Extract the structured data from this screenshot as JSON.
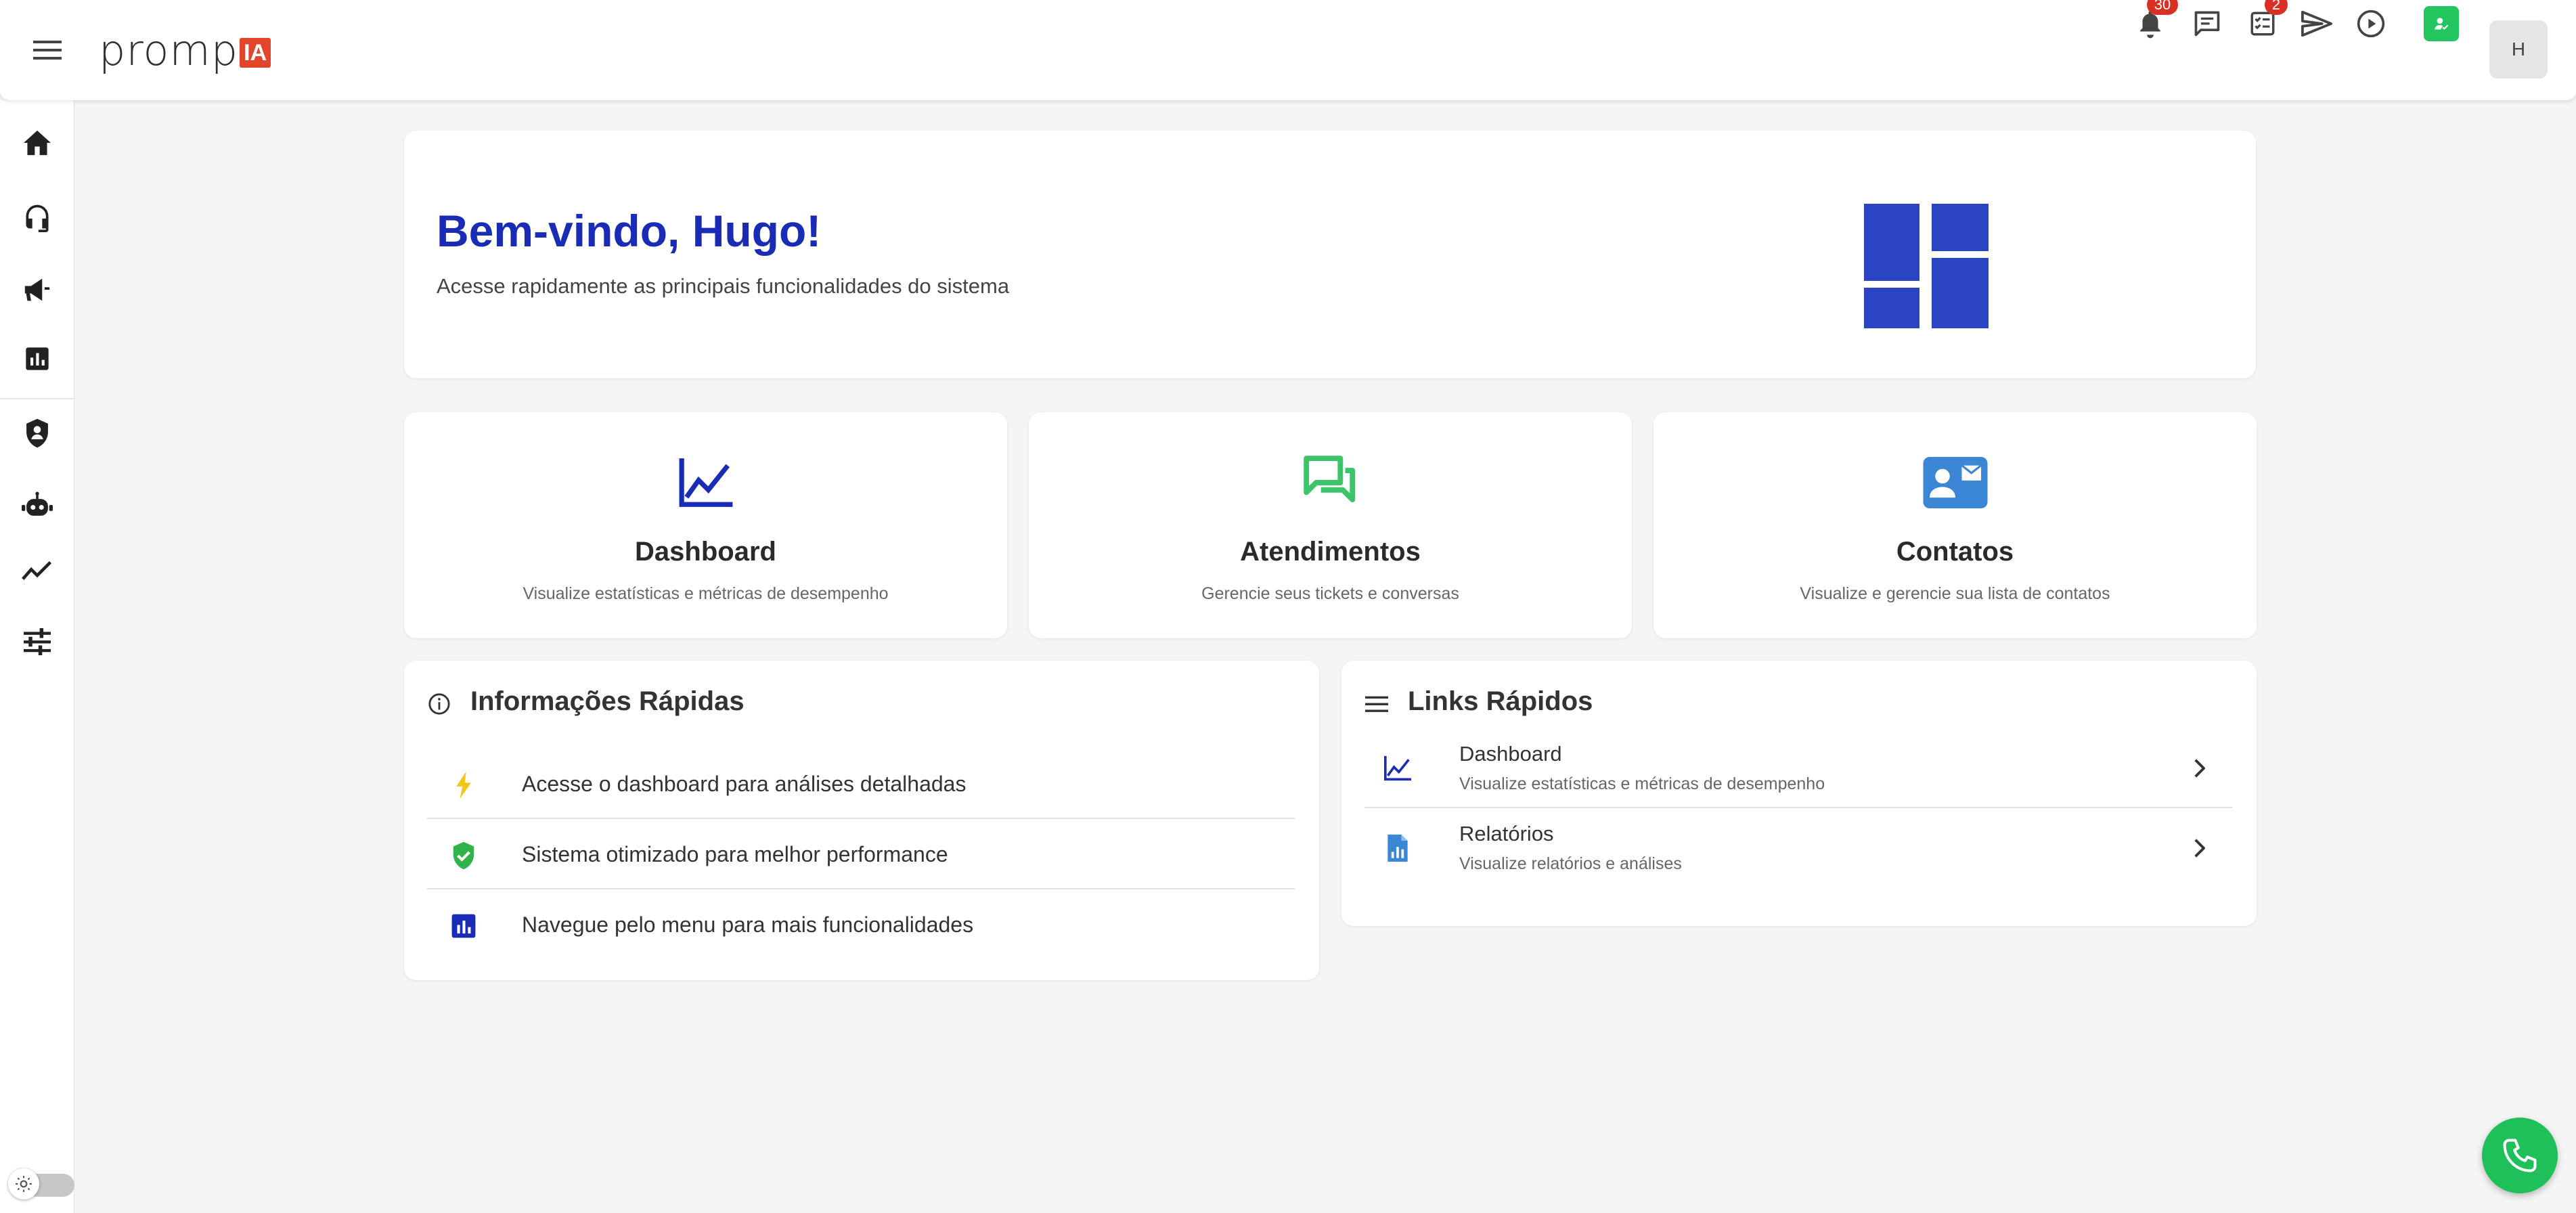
{
  "app": {
    "logo_text": "promp",
    "logo_badge": "IA"
  },
  "header": {
    "notifications_count": "30",
    "tasks_count": "2",
    "user_initial": "H"
  },
  "welcome": {
    "title": "Bem-vindo, Hugo!",
    "subtitle": "Acesse rapidamente as principais funcionalidades do sistema"
  },
  "features": [
    {
      "title": "Dashboard",
      "subtitle": "Visualize estatísticas e métricas de desempenho",
      "icon": "chart-line-icon",
      "color": "#1a2bb5"
    },
    {
      "title": "Atendimentos",
      "subtitle": "Gerencie seus tickets e conversas",
      "icon": "forum-icon",
      "color": "#3cc468"
    },
    {
      "title": "Contatos",
      "subtitle": "Visualize e gerencie sua lista de contatos",
      "icon": "contact-mail-icon",
      "color": "#3b87d6"
    }
  ],
  "info_panel": {
    "title": "Informações Rápidas",
    "items": [
      {
        "text": "Acesse o dashboard para análises detalhadas",
        "icon": "bolt-icon",
        "color": "#f5c518"
      },
      {
        "text": "Sistema otimizado para melhor performance",
        "icon": "verified-shield-icon",
        "color": "#2fb34a"
      },
      {
        "text": "Navegue pelo menu para mais funcionalidades",
        "icon": "bar-chart-icon",
        "color": "#1a2bb5"
      }
    ]
  },
  "links_panel": {
    "title": "Links Rápidos",
    "items": [
      {
        "title": "Dashboard",
        "subtitle": "Visualize estatísticas e métricas de desempenho",
        "icon": "chart-line-icon"
      },
      {
        "title": "Relatórios",
        "subtitle": "Visualize relatórios e análises",
        "icon": "report-file-icon"
      }
    ]
  },
  "colors": {
    "primary": "#1a2bb5",
    "accent_green": "#22c55e",
    "badge_red": "#d93025"
  }
}
